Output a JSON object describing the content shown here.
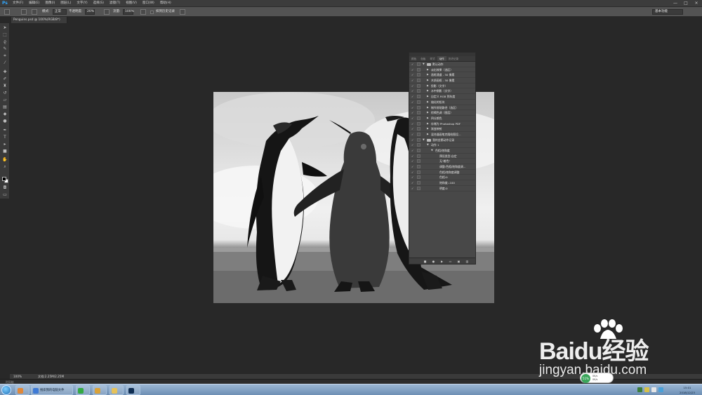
{
  "app": {
    "logo": "Ps",
    "menu": [
      "文件(F)",
      "编辑(E)",
      "图像(I)",
      "图层(L)",
      "文字(Y)",
      "选择(S)",
      "滤镜(T)",
      "视图(V)",
      "窗口(W)",
      "帮助(H)"
    ],
    "window_controls": [
      "—",
      "□",
      "×"
    ]
  },
  "options_bar": {
    "mode_label": "模式:",
    "mode_value": "正常",
    "opacity_label": "不透明度:",
    "opacity_value": "20%",
    "flow_label": "流量:",
    "flow_value": "100%",
    "history_label": "抹到历史记录",
    "workspace": "基本功能"
  },
  "document": {
    "tab_title": "Penguins.psd @ 100%(RGB/8*)"
  },
  "actions_panel": {
    "tabs": [
      "颜色",
      "色板",
      "样式",
      "动作",
      "历史记录"
    ],
    "active_tab": "动作",
    "rows": [
      {
        "label": "默认动作",
        "type": "set",
        "indent": 0,
        "expanded": true
      },
      {
        "label": "淡出效果（选区）",
        "type": "action",
        "indent": 1
      },
      {
        "label": "画框通道 - 50 像素",
        "type": "action",
        "indent": 1
      },
      {
        "label": "木质画框 - 50 像素",
        "type": "action",
        "indent": 1
      },
      {
        "label": "投影（文字）",
        "type": "action",
        "indent": 1
      },
      {
        "label": "水中倒影（文字）",
        "type": "action",
        "indent": 1
      },
      {
        "label": "自定义 RGB 到灰度",
        "type": "action",
        "indent": 1
      },
      {
        "label": "熔化的铅块",
        "type": "action",
        "indent": 1
      },
      {
        "label": "制作剪贴路径（选区）",
        "type": "action",
        "indent": 1
      },
      {
        "label": "棕褐色调（图层）",
        "type": "action",
        "indent": 1
      },
      {
        "label": "四分颜色",
        "type": "action",
        "indent": 1
      },
      {
        "label": "存储为 Photoshop PDF",
        "type": "action",
        "indent": 1
      },
      {
        "label": "渐变映射",
        "type": "action",
        "indent": 1
      },
      {
        "label": "混合器画笔克隆绘图设...",
        "type": "action",
        "indent": 1
      },
      {
        "label": "我的金鹅动作记录",
        "type": "set",
        "indent": 0,
        "expanded": true
      },
      {
        "label": "动作 1",
        "type": "action",
        "indent": 1,
        "expanded": true
      },
      {
        "label": "色相/饱和度",
        "type": "step",
        "indent": 2,
        "expanded": true
      },
      {
        "label": "预设类型:自定",
        "type": "detail",
        "indent": 3
      },
      {
        "label": "无\"着色\"",
        "type": "detail",
        "indent": 3
      },
      {
        "label": "调整:色相/饱和度调...",
        "type": "detail",
        "indent": 3
      },
      {
        "label": "色相/饱和度调整",
        "type": "detail",
        "indent": 3
      },
      {
        "label": "色相:0",
        "type": "detail",
        "indent": 3
      },
      {
        "label": "饱和度:-100",
        "type": "detail",
        "indent": 3
      },
      {
        "label": "明度:0",
        "type": "detail",
        "indent": 3
      }
    ],
    "bottom_icons": [
      "stop-icon",
      "record-icon",
      "play-icon",
      "new-set-icon",
      "new-action-icon",
      "delete-icon"
    ]
  },
  "status_bar": {
    "zoom": "100%",
    "doc_info": "文档:2.25M/2.25M"
  },
  "timeline": {
    "label": "时间轴"
  },
  "taskbar": {
    "items": [
      {
        "label": "搜索我的电脑文件",
        "icon": "search-icon",
        "color": "#3f7bd6"
      },
      {
        "label": "",
        "icon": "browser-icon",
        "color": "#33aa44"
      },
      {
        "label": "",
        "icon": "paint-icon",
        "color": "#d9a23a"
      },
      {
        "label": "",
        "icon": "folder-icon",
        "color": "#e6c25a"
      },
      {
        "label": "",
        "icon": "photoshop-icon",
        "color": "#0f2d52"
      }
    ],
    "clock_time": "15:01",
    "clock_date": "2018/12/23"
  },
  "speed_widget": {
    "percent": "51%",
    "line1": "0K/s",
    "line2": "0K/s"
  },
  "watermark": {
    "brand_left": "Bai",
    "brand_mid": "du",
    "brand_right": "经验",
    "url": "jingyan.baidu.com"
  }
}
